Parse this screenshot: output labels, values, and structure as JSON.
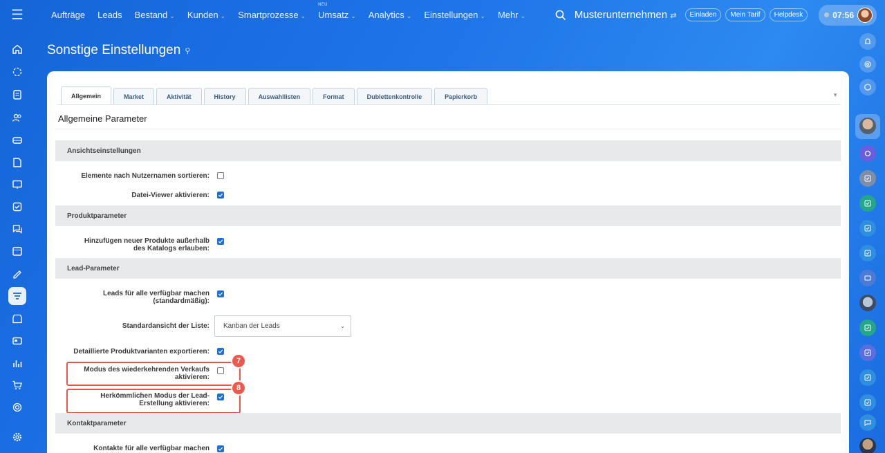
{
  "topbar": {
    "nav": [
      {
        "label": "Aufträge",
        "caret": false
      },
      {
        "label": "Leads",
        "caret": false
      },
      {
        "label": "Bestand",
        "caret": true
      },
      {
        "label": "Kunden",
        "caret": true
      },
      {
        "label": "Smartprozesse",
        "caret": true
      },
      {
        "label": "Umsatz",
        "caret": true,
        "badge": "NEU"
      },
      {
        "label": "Analytics",
        "caret": true
      },
      {
        "label": "Einstellungen",
        "caret": true
      },
      {
        "label": "Mehr",
        "caret": true
      }
    ],
    "company": "Musterunternehmen",
    "invite": "Einladen",
    "plan": "Mein Tarif",
    "helpdesk": "Helpdesk",
    "time": "07:56"
  },
  "page": {
    "title": "Sonstige Einstellungen"
  },
  "tabs": [
    "Allgemein",
    "Market",
    "Aktivität",
    "History",
    "Auswahllisten",
    "Format",
    "Dublettenkontrolle",
    "Papierkorb"
  ],
  "section_title": "Allgemeine Parameter",
  "groups": {
    "view": "Ansichtseinstellungen",
    "product": "Produktparameter",
    "lead": "Lead-Parameter",
    "contact": "Kontaktparameter"
  },
  "rows": {
    "sort_by_user": {
      "label": "Elemente nach Nutzernamen sortieren:",
      "checked": false
    },
    "file_viewer": {
      "label": "Datei-Viewer aktivieren:",
      "checked": true
    },
    "add_products_l1": "Hinzufügen neuer Produkte außerhalb",
    "add_products_l2": "des Katalogs erlauben:",
    "add_products_checked": true,
    "leads_all_l1": "Leads für alle verfügbar machen",
    "leads_all_l2": "(standardmäßig):",
    "leads_all_checked": true,
    "default_view_label": "Standardansicht der Liste:",
    "default_view_value": "Kanban der Leads",
    "export_variants": {
      "label": "Detaillierte Produktvarianten exportieren:",
      "checked": true
    },
    "recurring_l1": "Modus des wiederkehrenden Verkaufs",
    "recurring_l2": "aktivieren:",
    "recurring_checked": false,
    "classic_l1": "Herkömmlichen Modus der Lead-",
    "classic_l2": "Erstellung aktivieren:",
    "classic_checked": true,
    "contacts_all": "Kontakte für alle verfügbar machen",
    "contacts_all_checked": true
  },
  "badges": {
    "first": "7",
    "second": "8"
  },
  "colors": {
    "accent": "#1f6fd0",
    "highlight": "#e2574c",
    "band": "#e8e9ea"
  }
}
